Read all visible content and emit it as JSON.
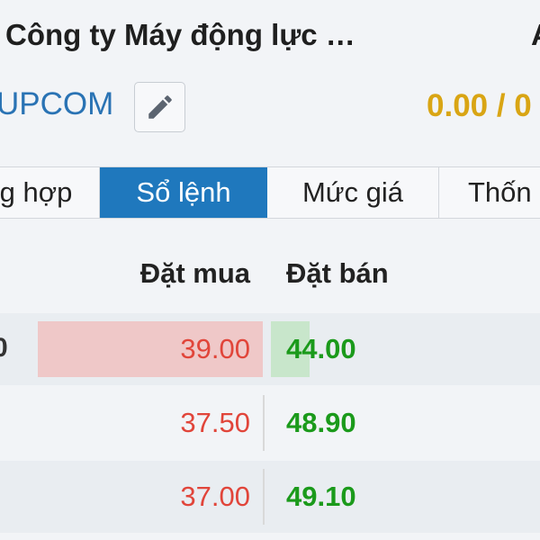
{
  "header": {
    "company_name": "Công ty Máy động lực …",
    "title_cut_text": "A",
    "exchange": "UPCOM",
    "edit_icon": "pencil-icon",
    "price_change": "0.00 / 0"
  },
  "tabs": [
    {
      "label": "g hợp",
      "active": false
    },
    {
      "label": "Sổ lệnh",
      "active": true
    },
    {
      "label": "Mức giá",
      "active": false
    },
    {
      "label": "Thốn",
      "active": false
    }
  ],
  "orderbook": {
    "bid_header": "Đặt mua",
    "ask_header": "Đặt bán",
    "rows": [
      {
        "edge_text": "0",
        "bid": "39.00",
        "ask": "44.00",
        "bid_volume_fraction": 1.0,
        "ask_volume_fraction": 0.17
      },
      {
        "edge_text": "",
        "bid": "37.50",
        "ask": "48.90",
        "bid_volume_fraction": 0,
        "ask_volume_fraction": 0
      },
      {
        "edge_text": "",
        "bid": "37.00",
        "ask": "49.10",
        "bid_volume_fraction": 0,
        "ask_volume_fraction": 0
      }
    ]
  },
  "colors": {
    "active_tab": "#1f78bd",
    "bid_price": "#e1453a",
    "ask_price": "#1b9a1b",
    "exchange_link": "#2a73b4",
    "price_change": "#d9a514",
    "bid_bar": "#efc8c8",
    "ask_bar": "#c8e6cb"
  }
}
